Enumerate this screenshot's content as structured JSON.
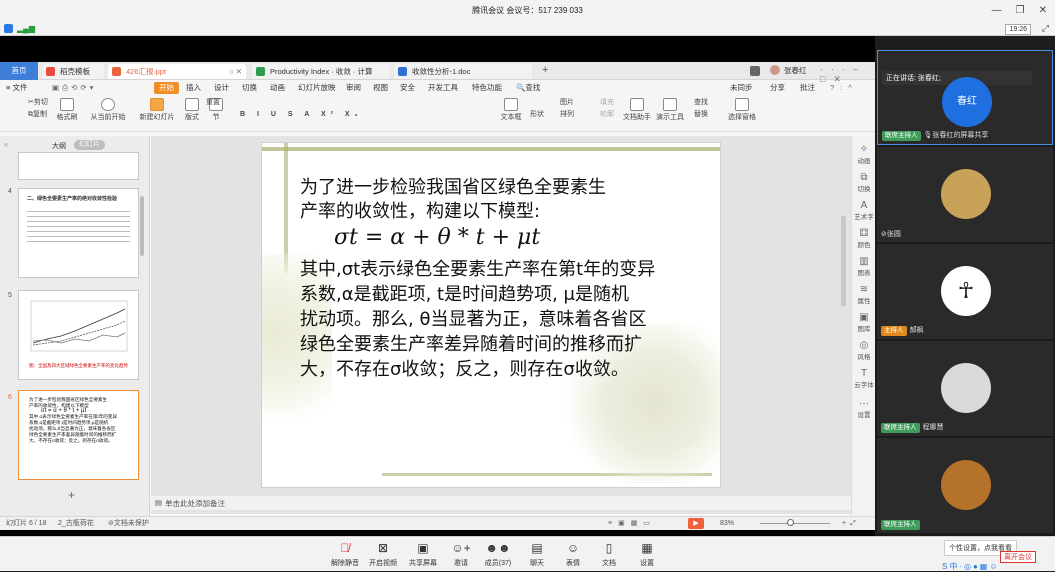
{
  "window": {
    "title": "腾讯会议 会议号：517 239 033",
    "time": "19:26"
  },
  "wps": {
    "home_tab": "首页",
    "tabs": [
      {
        "label": "稻壳模板",
        "color": "#e84c3d"
      },
      {
        "label": "426汇报.ppt",
        "color": "#e8663d"
      },
      {
        "label": "Productivity Index · 收敛 · 计算",
        "color": "#2e9d4b"
      },
      {
        "label": "收敛性分析-1.doc",
        "color": "#2f6fd4"
      }
    ],
    "user_name": "张春红",
    "menu": [
      "≡ 文件",
      "开始",
      "插入",
      "设计",
      "切换",
      "动画",
      "幻灯片放映",
      "审阅",
      "视图",
      "安全",
      "开发工具",
      "特色功能",
      "查找"
    ],
    "menu_right": [
      "未同步",
      "分享",
      "批注"
    ],
    "ribbon": [
      "剪切",
      "复制",
      "格式刷",
      "从当前开始",
      "新建幻灯片",
      "版式",
      "节",
      "重置",
      "文本框",
      "形状",
      "排列",
      "图片",
      "填充",
      "轮廓",
      "文档助手",
      "演示工具",
      "替换",
      "查找",
      "选择窗格"
    ],
    "panel_tabs": [
      "大纲",
      "幻灯片"
    ],
    "thumbs": [
      {
        "num": "4",
        "title": "二、绿色全要素生产率的绝对收敛性检验"
      },
      {
        "num": "5",
        "caption": "图：全国及四大区域绿色全要素生产率的变化趋势"
      },
      {
        "num": "6",
        "lines": [
          "为了进一步检验我国省区绿色全要素生",
          "产率的收敛性，构建以下模型",
          "σt = α + θ * t + μt",
          "其中,σ表示绿色全要素生产率在第t年的变异",
          "系数,α是截距项,t是时间趋势项,μ是随机",
          "扰动项。那么,θ当显著为正，意味着各省区",
          "绿色全要素生产率差异随着时间的推移而扩",
          "大，不存在σ收敛；反之，则存在σ收敛。"
        ]
      }
    ],
    "add_slide": "+",
    "notes_placeholder": "单击此处添加备注",
    "status": {
      "slide_info": "幻灯片 6 / 18",
      "theme": "2_古瓶荷花",
      "protect": "文档未保护",
      "zoom": "83%"
    },
    "right_tools": [
      "动画",
      "切换",
      "艺术字",
      "颜色",
      "图表",
      "属性",
      "图库",
      "风格",
      "云字体",
      "设置"
    ]
  },
  "slide": {
    "line1": "为了进一步检验我国省区绿色全要素生",
    "line2": "产率的收敛性，构建以下模型:",
    "formula": "σt = α + θ * t + μt",
    "body": [
      "其中,σt表示绿色全要素生产率在第t年的变异",
      "系数,α是截距项, t是时间趋势项, μ是随机",
      "扰动项。那么, θ当显著为正，意味着各省区",
      "绿色全要素生产率差异随着时间的推移而扩",
      "大，不存在σ收敛；反之，则存在σ收敛。"
    ]
  },
  "participants": {
    "speaking": "正在讲话: 张春红;",
    "list": [
      {
        "name": "张春红的屏幕共享",
        "badge": "联席主持人",
        "avatar_text": "春红",
        "avatar_color": "#1f6fe0",
        "badge_color": "#3f9c5a"
      },
      {
        "name": "张圆",
        "badge": "",
        "avatar_color": "#c9a25a"
      },
      {
        "name": "郝枫",
        "badge": "主持人",
        "avatar_color": "#ffffff",
        "badge_color": "#e08a1e"
      },
      {
        "name": "程娜慧",
        "badge": "联席主持人",
        "avatar_color": "#d9d9d9",
        "badge_color": "#3f9c5a"
      },
      {
        "name": "",
        "badge": "联席主持人",
        "avatar_color": "#b5722a",
        "badge_color": "#3f9c5a"
      }
    ],
    "tooltip": "个性设置，点我看看",
    "leave": "离开会议"
  },
  "controls": [
    "解除静音",
    "开启视频",
    "共享屏幕",
    "邀请",
    "成员(37)",
    "聊天",
    "表情",
    "文档",
    "设置"
  ]
}
